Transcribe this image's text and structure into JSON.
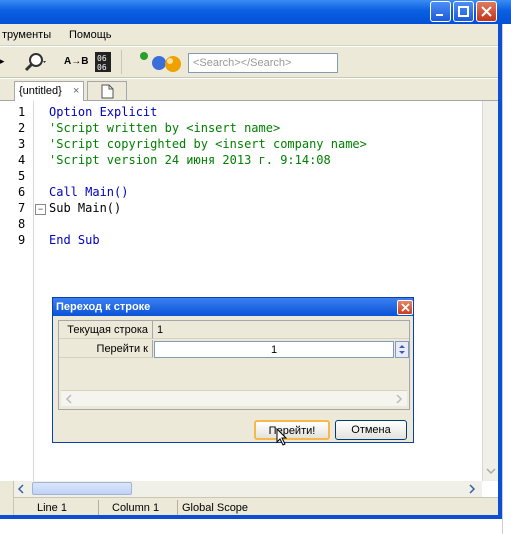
{
  "menubar": {
    "items": [
      "трументы",
      "Помощь"
    ]
  },
  "toolbar": {
    "search_placeholder": "<Search></Search>",
    "find_icon": "magnifier-icon",
    "replace_label": "A→B"
  },
  "tabs": [
    {
      "label": "{untitled}"
    }
  ],
  "editor": {
    "lines": [
      {
        "num": "1",
        "text": "Option Explicit",
        "kind": "keyword"
      },
      {
        "num": "2",
        "text": "'Script written by <insert name>",
        "kind": "comment"
      },
      {
        "num": "3",
        "text": "'Script copyrighted by <insert company name>",
        "kind": "comment"
      },
      {
        "num": "4",
        "text": "'Script version 24 июня 2013 г. 9:14:08",
        "kind": "comment"
      },
      {
        "num": "5",
        "text": "",
        "kind": "plain"
      },
      {
        "num": "6",
        "text": "Call Main()",
        "kind": "keyword"
      },
      {
        "num": "7",
        "text": "Sub Main()",
        "kind": "plain"
      },
      {
        "num": "8",
        "text": "",
        "kind": "plain"
      },
      {
        "num": "9",
        "text": "End Sub",
        "kind": "keyword"
      }
    ]
  },
  "status": {
    "line": "Line 1",
    "column": "Column 1",
    "scope": "Global Scope"
  },
  "dialog": {
    "title": "Переход к строке",
    "current_label": "Текущая строка",
    "current_value": "1",
    "goto_label": "Перейти к",
    "goto_value": "1",
    "ok_label": "Перейти!",
    "cancel_label": "Отмена"
  },
  "colors": {
    "keyword": "#0000c0",
    "comment": "#008000",
    "titlebar": "#0a5fe0"
  }
}
